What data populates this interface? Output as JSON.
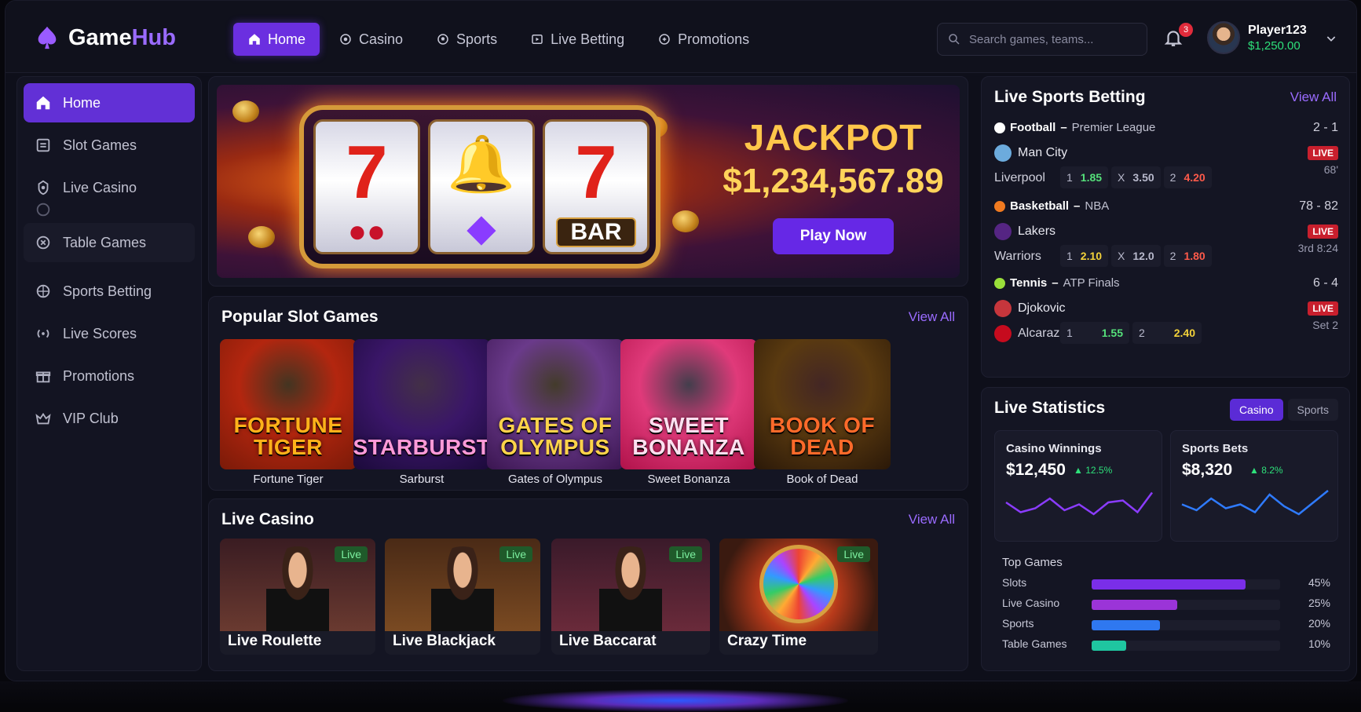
{
  "brand": {
    "name_a": "Game",
    "name_b": "Hub"
  },
  "nav": [
    {
      "label": "Home",
      "icon": "home-icon",
      "active": true
    },
    {
      "label": "Casino",
      "icon": "casino-chip-icon"
    },
    {
      "label": "Sports",
      "icon": "soccer-ball-icon"
    },
    {
      "label": "Live Betting",
      "icon": "live-icon"
    },
    {
      "label": "Promotions",
      "icon": "tag-icon"
    }
  ],
  "search": {
    "placeholder": "Search games, teams..."
  },
  "notifications": {
    "count": "3"
  },
  "user": {
    "name": "Player123",
    "balance": "$1,250.00"
  },
  "sidebar": [
    {
      "label": "Home",
      "icon": "home-icon"
    },
    {
      "label": "Slot Games",
      "icon": "slot-machine-icon"
    },
    {
      "label": "Live Casino",
      "icon": "live-casino-icon"
    },
    {
      "label": "Table Games",
      "icon": "table-games-icon"
    },
    {
      "label": "Sports Betting",
      "icon": "sports-ball-icon"
    },
    {
      "label": "Live Scores",
      "icon": "broadcast-icon"
    },
    {
      "label": "Promotions",
      "icon": "gift-icon"
    },
    {
      "label": "VIP Club",
      "icon": "crown-icon"
    }
  ],
  "hero": {
    "title": "JACKPOT",
    "amount": "$1,234,567.89",
    "cta": "Play Now",
    "reel_text": "BAR"
  },
  "popular_slots": {
    "title": "Popular Slot Games",
    "view_all": "View All",
    "games": [
      {
        "art": "FORTUNE TIGER",
        "caption": "Fortune Tiger",
        "bg": "#b3260f"
      },
      {
        "art": "STARBURST",
        "caption": "Sarburst",
        "bg": "#3a1668"
      },
      {
        "art": "GATES OF OLYMPUS",
        "caption": "Gates of Olympus",
        "bg": "#6a3a8a"
      },
      {
        "art": "SWEET BONANZA",
        "caption": "Sweet Bonanza",
        "bg": "#e03a7a"
      },
      {
        "art": "BOOK OF DEAD",
        "caption": "Book of Dead",
        "bg": "#5a3a10"
      }
    ]
  },
  "live_casino": {
    "title": "Live Casino",
    "view_all": "View All",
    "badge": "Live",
    "tables": [
      {
        "label": "Live Roulette"
      },
      {
        "label": "Live Blackjack"
      },
      {
        "label": "Live Baccarat"
      },
      {
        "label": "Crazy Time"
      }
    ]
  },
  "live_sports": {
    "title": "Live Sports Betting",
    "view_all": "View All",
    "live_label": "LIVE",
    "matches": [
      {
        "sport": "Football",
        "league": "Premier League",
        "score": "2 - 1",
        "team1": "Man City",
        "team2": "Liverpool",
        "time": "68'",
        "odds": [
          {
            "k": "1",
            "v": "1.85",
            "c": "g"
          },
          {
            "k": "X",
            "v": "3.50",
            "c": ""
          },
          {
            "k": "2",
            "v": "4.20",
            "c": "r"
          }
        ]
      },
      {
        "sport": "Basketball",
        "league": "NBA",
        "score": "78 - 82",
        "team1": "Lakers",
        "team2": "Warriors",
        "time": "3rd 8:24",
        "odds": [
          {
            "k": "1",
            "v": "2.10",
            "c": "y"
          },
          {
            "k": "X",
            "v": "12.0",
            "c": ""
          },
          {
            "k": "2",
            "v": "1.80",
            "c": "r"
          }
        ]
      },
      {
        "sport": "Tennis",
        "league": "ATP Finals",
        "score": "6 - 4",
        "team1": "Djokovic",
        "team2": "Alcaraz",
        "time": "Set 2",
        "odds": [
          {
            "k": "1",
            "v": "1.55",
            "c": "g"
          },
          {
            "k": "2",
            "v": "2.40",
            "c": "y"
          }
        ]
      }
    ]
  },
  "live_stats": {
    "title": "Live Statistics",
    "tabs": [
      "Casino",
      "Sports"
    ],
    "cards": [
      {
        "label": "Casino Winnings",
        "value": "$12,450",
        "delta": "12.5%",
        "color": "#8b3cff"
      },
      {
        "label": "Sports Bets",
        "value": "$8,320",
        "delta": "8.2%",
        "color": "#2f7bff"
      }
    ],
    "top_games_label": "Top Games",
    "top_games": [
      {
        "label": "Slots",
        "pct": "45%",
        "value": 0.45,
        "color": "#7a2ee8"
      },
      {
        "label": "Live Casino",
        "pct": "25%",
        "value": 0.25,
        "color": "#9b34d8"
      },
      {
        "label": "Sports",
        "pct": "20%",
        "value": 0.2,
        "color": "#2f78f0"
      },
      {
        "label": "Table Games",
        "pct": "10%",
        "value": 0.1,
        "color": "#1fc6a0"
      }
    ]
  }
}
